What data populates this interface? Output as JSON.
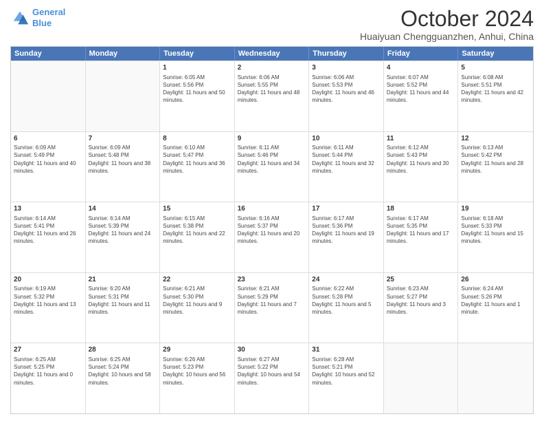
{
  "logo": {
    "line1": "General",
    "line2": "Blue"
  },
  "title": "October 2024",
  "subtitle": "Huaiyuan Chengguanzhen, Anhui, China",
  "days": [
    "Sunday",
    "Monday",
    "Tuesday",
    "Wednesday",
    "Thursday",
    "Friday",
    "Saturday"
  ],
  "rows": [
    [
      {
        "day": "",
        "sunrise": "",
        "sunset": "",
        "daylight": ""
      },
      {
        "day": "",
        "sunrise": "",
        "sunset": "",
        "daylight": ""
      },
      {
        "day": "1",
        "sunrise": "Sunrise: 6:05 AM",
        "sunset": "Sunset: 5:56 PM",
        "daylight": "Daylight: 11 hours and 50 minutes."
      },
      {
        "day": "2",
        "sunrise": "Sunrise: 6:06 AM",
        "sunset": "Sunset: 5:55 PM",
        "daylight": "Daylight: 11 hours and 48 minutes."
      },
      {
        "day": "3",
        "sunrise": "Sunrise: 6:06 AM",
        "sunset": "Sunset: 5:53 PM",
        "daylight": "Daylight: 11 hours and 46 minutes."
      },
      {
        "day": "4",
        "sunrise": "Sunrise: 6:07 AM",
        "sunset": "Sunset: 5:52 PM",
        "daylight": "Daylight: 11 hours and 44 minutes."
      },
      {
        "day": "5",
        "sunrise": "Sunrise: 6:08 AM",
        "sunset": "Sunset: 5:51 PM",
        "daylight": "Daylight: 11 hours and 42 minutes."
      }
    ],
    [
      {
        "day": "6",
        "sunrise": "Sunrise: 6:09 AM",
        "sunset": "Sunset: 5:49 PM",
        "daylight": "Daylight: 11 hours and 40 minutes."
      },
      {
        "day": "7",
        "sunrise": "Sunrise: 6:09 AM",
        "sunset": "Sunset: 5:48 PM",
        "daylight": "Daylight: 11 hours and 38 minutes."
      },
      {
        "day": "8",
        "sunrise": "Sunrise: 6:10 AM",
        "sunset": "Sunset: 5:47 PM",
        "daylight": "Daylight: 11 hours and 36 minutes."
      },
      {
        "day": "9",
        "sunrise": "Sunrise: 6:11 AM",
        "sunset": "Sunset: 5:46 PM",
        "daylight": "Daylight: 11 hours and 34 minutes."
      },
      {
        "day": "10",
        "sunrise": "Sunrise: 6:11 AM",
        "sunset": "Sunset: 5:44 PM",
        "daylight": "Daylight: 11 hours and 32 minutes."
      },
      {
        "day": "11",
        "sunrise": "Sunrise: 6:12 AM",
        "sunset": "Sunset: 5:43 PM",
        "daylight": "Daylight: 11 hours and 30 minutes."
      },
      {
        "day": "12",
        "sunrise": "Sunrise: 6:13 AM",
        "sunset": "Sunset: 5:42 PM",
        "daylight": "Daylight: 11 hours and 28 minutes."
      }
    ],
    [
      {
        "day": "13",
        "sunrise": "Sunrise: 6:14 AM",
        "sunset": "Sunset: 5:41 PM",
        "daylight": "Daylight: 11 hours and 26 minutes."
      },
      {
        "day": "14",
        "sunrise": "Sunrise: 6:14 AM",
        "sunset": "Sunset: 5:39 PM",
        "daylight": "Daylight: 11 hours and 24 minutes."
      },
      {
        "day": "15",
        "sunrise": "Sunrise: 6:15 AM",
        "sunset": "Sunset: 5:38 PM",
        "daylight": "Daylight: 11 hours and 22 minutes."
      },
      {
        "day": "16",
        "sunrise": "Sunrise: 6:16 AM",
        "sunset": "Sunset: 5:37 PM",
        "daylight": "Daylight: 11 hours and 20 minutes."
      },
      {
        "day": "17",
        "sunrise": "Sunrise: 6:17 AM",
        "sunset": "Sunset: 5:36 PM",
        "daylight": "Daylight: 11 hours and 19 minutes."
      },
      {
        "day": "18",
        "sunrise": "Sunrise: 6:17 AM",
        "sunset": "Sunset: 5:35 PM",
        "daylight": "Daylight: 11 hours and 17 minutes."
      },
      {
        "day": "19",
        "sunrise": "Sunrise: 6:18 AM",
        "sunset": "Sunset: 5:33 PM",
        "daylight": "Daylight: 11 hours and 15 minutes."
      }
    ],
    [
      {
        "day": "20",
        "sunrise": "Sunrise: 6:19 AM",
        "sunset": "Sunset: 5:32 PM",
        "daylight": "Daylight: 11 hours and 13 minutes."
      },
      {
        "day": "21",
        "sunrise": "Sunrise: 6:20 AM",
        "sunset": "Sunset: 5:31 PM",
        "daylight": "Daylight: 11 hours and 11 minutes."
      },
      {
        "day": "22",
        "sunrise": "Sunrise: 6:21 AM",
        "sunset": "Sunset: 5:30 PM",
        "daylight": "Daylight: 11 hours and 9 minutes."
      },
      {
        "day": "23",
        "sunrise": "Sunrise: 6:21 AM",
        "sunset": "Sunset: 5:29 PM",
        "daylight": "Daylight: 11 hours and 7 minutes."
      },
      {
        "day": "24",
        "sunrise": "Sunrise: 6:22 AM",
        "sunset": "Sunset: 5:28 PM",
        "daylight": "Daylight: 11 hours and 5 minutes."
      },
      {
        "day": "25",
        "sunrise": "Sunrise: 6:23 AM",
        "sunset": "Sunset: 5:27 PM",
        "daylight": "Daylight: 11 hours and 3 minutes."
      },
      {
        "day": "26",
        "sunrise": "Sunrise: 6:24 AM",
        "sunset": "Sunset: 5:26 PM",
        "daylight": "Daylight: 11 hours and 1 minute."
      }
    ],
    [
      {
        "day": "27",
        "sunrise": "Sunrise: 6:25 AM",
        "sunset": "Sunset: 5:25 PM",
        "daylight": "Daylight: 11 hours and 0 minutes."
      },
      {
        "day": "28",
        "sunrise": "Sunrise: 6:25 AM",
        "sunset": "Sunset: 5:24 PM",
        "daylight": "Daylight: 10 hours and 58 minutes."
      },
      {
        "day": "29",
        "sunrise": "Sunrise: 6:26 AM",
        "sunset": "Sunset: 5:23 PM",
        "daylight": "Daylight: 10 hours and 56 minutes."
      },
      {
        "day": "30",
        "sunrise": "Sunrise: 6:27 AM",
        "sunset": "Sunset: 5:22 PM",
        "daylight": "Daylight: 10 hours and 54 minutes."
      },
      {
        "day": "31",
        "sunrise": "Sunrise: 6:28 AM",
        "sunset": "Sunset: 5:21 PM",
        "daylight": "Daylight: 10 hours and 52 minutes."
      },
      {
        "day": "",
        "sunrise": "",
        "sunset": "",
        "daylight": ""
      },
      {
        "day": "",
        "sunrise": "",
        "sunset": "",
        "daylight": ""
      }
    ]
  ]
}
